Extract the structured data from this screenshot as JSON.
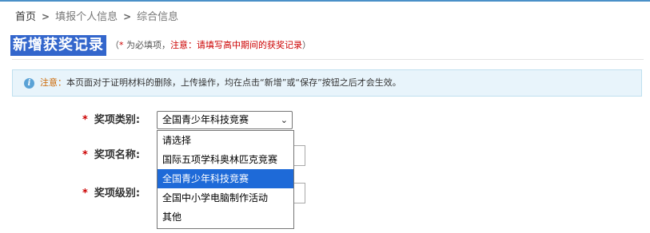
{
  "breadcrumb": {
    "home": "首页",
    "items": [
      "填报个人信息",
      "综合信息"
    ]
  },
  "page_title": "新增获奖记录",
  "title_note": {
    "prefix": "（",
    "star": "*",
    "required_text": " 为必填项，",
    "attention_label": "注意：",
    "attention_text": "请填写高中期间的获奖记录",
    "suffix": "）"
  },
  "notice": {
    "icon": "info-icon",
    "label": "注意：",
    "text": "本页面对于证明材料的删除，上传操作，均在点击“新增”或“保存”按钮之后才会生效。"
  },
  "form": {
    "award_category": {
      "label": "奖项类别:",
      "required": "*",
      "selected": "全国青少年科技竞赛",
      "options": [
        "请选择",
        "国际五项学科奥林匹克竞赛",
        "全国青少年科技竞赛",
        "全国中小学电脑制作活动",
        "其他"
      ],
      "selected_index": 2
    },
    "award_name": {
      "label": "奖项名称:",
      "required": "*"
    },
    "award_level": {
      "label": "奖项级别:",
      "required": "*"
    }
  },
  "colors": {
    "title_bg": "#3366cc",
    "notice_bg": "#e8f4fb",
    "required_red": "#cc0000",
    "selected_option": "#1e6ad8"
  }
}
